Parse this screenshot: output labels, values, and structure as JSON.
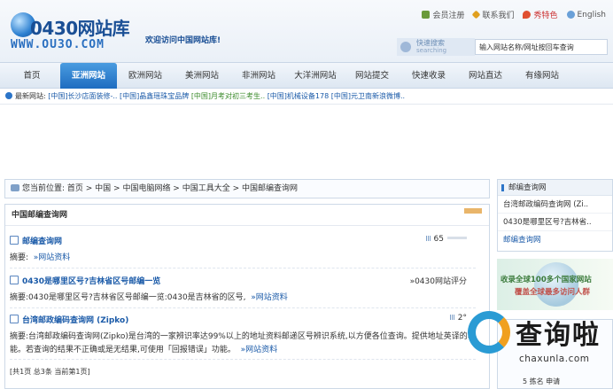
{
  "logo": {
    "title": "0430网站库",
    "url": "WWW.OU3O.COM"
  },
  "welcome": "欢迎访问中国网站库!",
  "toplinks": {
    "register": "会员注册",
    "contact": "联系我们",
    "show": "秀特色",
    "english": "English"
  },
  "search": {
    "label": "快速搜索",
    "label_sub": "searching",
    "value": "输入网站名称/网址按回车查询"
  },
  "nav": [
    "首页",
    "亚洲网站",
    "欧洲网站",
    "美洲网站",
    "非洲网站",
    "大洋洲网站",
    "网站提交",
    "快速收录",
    "网站直达",
    "有缘网站"
  ],
  "nav_active": 1,
  "newsites": {
    "label": "最新网站:",
    "items": [
      "[中国]长沙店面装修-..",
      "[中国]晶鑫瑶珠宝品牌",
      "[中国]月考对初三考生..",
      "[中国]机械设备178",
      "[中国]元卫南新浪微博.."
    ]
  },
  "breadcrumb": {
    "prefix": "您当前位置:",
    "path": "首页 > 中国 > 中国电脑网络 > 中国工具大全 > 中国邮编查询网"
  },
  "list": {
    "title": "中国邮编查询网",
    "summary_label": "摘要:",
    "entries": [
      {
        "title": "邮编查询网",
        "summary": "»网站资料",
        "rating": "65"
      },
      {
        "title": "0430是哪里区号?吉林省区号邮编一览",
        "summary": "0430是哪里区号?吉林省区号邮编一览:0430是吉林省的区号,",
        "link": "»网站资料",
        "rating": "»0430网站评分"
      },
      {
        "title": "台湾邮政编码查询网 (Zipko)",
        "summary": "台湾邮政编码查询网(Zipko)是台湾的一家辨识率达99%以上的地址资料邮递区号辨识系统,以方便各位查询。提供地址英译的功能。若查询的结果不正确或是无结果,可使用「回报错误」功能。",
        "link": "»网站资料",
        "rating": "2°"
      }
    ],
    "pager": "[共1页 总3条 当前第1页]"
  },
  "side": {
    "header": "邮编查询网",
    "items": [
      "台湾邮政编码查询网 (Zi..",
      "0430是哪里区号?吉林省.."
    ],
    "link": "邮编查询网"
  },
  "banner": {
    "line1": "收录全球100多个国家网站",
    "line2": "覆盖全球最多访问人群"
  },
  "rank_row": "5  拣名  申请",
  "watermark": {
    "cn": "查询啦",
    "en": "chaxunla.com"
  }
}
